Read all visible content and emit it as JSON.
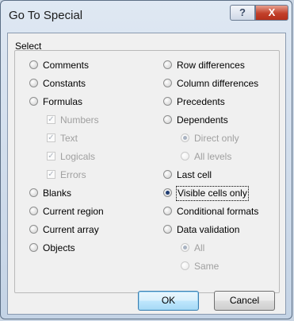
{
  "window": {
    "title": "Go To Special",
    "help_glyph": "?",
    "close_glyph": "X"
  },
  "group": {
    "label": "Select"
  },
  "options_left": [
    {
      "label": "Comments",
      "type": "radio",
      "checked": false,
      "disabled": false
    },
    {
      "label": "Constants",
      "type": "radio",
      "checked": false,
      "disabled": false
    },
    {
      "label": "Formulas",
      "type": "radio",
      "checked": false,
      "disabled": false
    },
    {
      "label": "Numbers",
      "type": "check",
      "checked": true,
      "disabled": true
    },
    {
      "label": "Text",
      "type": "check",
      "checked": true,
      "disabled": true
    },
    {
      "label": "Logicals",
      "type": "check",
      "checked": true,
      "disabled": true
    },
    {
      "label": "Errors",
      "type": "check",
      "checked": true,
      "disabled": true
    },
    {
      "label": "Blanks",
      "type": "radio",
      "checked": false,
      "disabled": false
    },
    {
      "label": "Current region",
      "type": "radio",
      "checked": false,
      "disabled": false
    },
    {
      "label": "Current array",
      "type": "radio",
      "checked": false,
      "disabled": false
    },
    {
      "label": "Objects",
      "type": "radio",
      "checked": false,
      "disabled": false
    }
  ],
  "options_right": [
    {
      "label": "Row differences",
      "type": "radio",
      "checked": false,
      "disabled": false
    },
    {
      "label": "Column differences",
      "type": "radio",
      "checked": false,
      "disabled": false
    },
    {
      "label": "Precedents",
      "type": "radio",
      "checked": false,
      "disabled": false
    },
    {
      "label": "Dependents",
      "type": "radio",
      "checked": false,
      "disabled": false
    },
    {
      "label": "Direct only",
      "type": "radio",
      "checked": true,
      "disabled": true
    },
    {
      "label": "All levels",
      "type": "radio",
      "checked": false,
      "disabled": true
    },
    {
      "label": "Last cell",
      "type": "radio",
      "checked": false,
      "disabled": false
    },
    {
      "label": "Visible cells only",
      "type": "radio",
      "checked": true,
      "disabled": false
    },
    {
      "label": "Conditional formats",
      "type": "radio",
      "checked": false,
      "disabled": false
    },
    {
      "label": "Data validation",
      "type": "radio",
      "checked": false,
      "disabled": false
    },
    {
      "label": "All",
      "type": "radio",
      "checked": true,
      "disabled": true
    },
    {
      "label": "Same",
      "type": "radio",
      "checked": false,
      "disabled": true
    }
  ],
  "buttons": {
    "ok": "OK",
    "cancel": "Cancel"
  }
}
